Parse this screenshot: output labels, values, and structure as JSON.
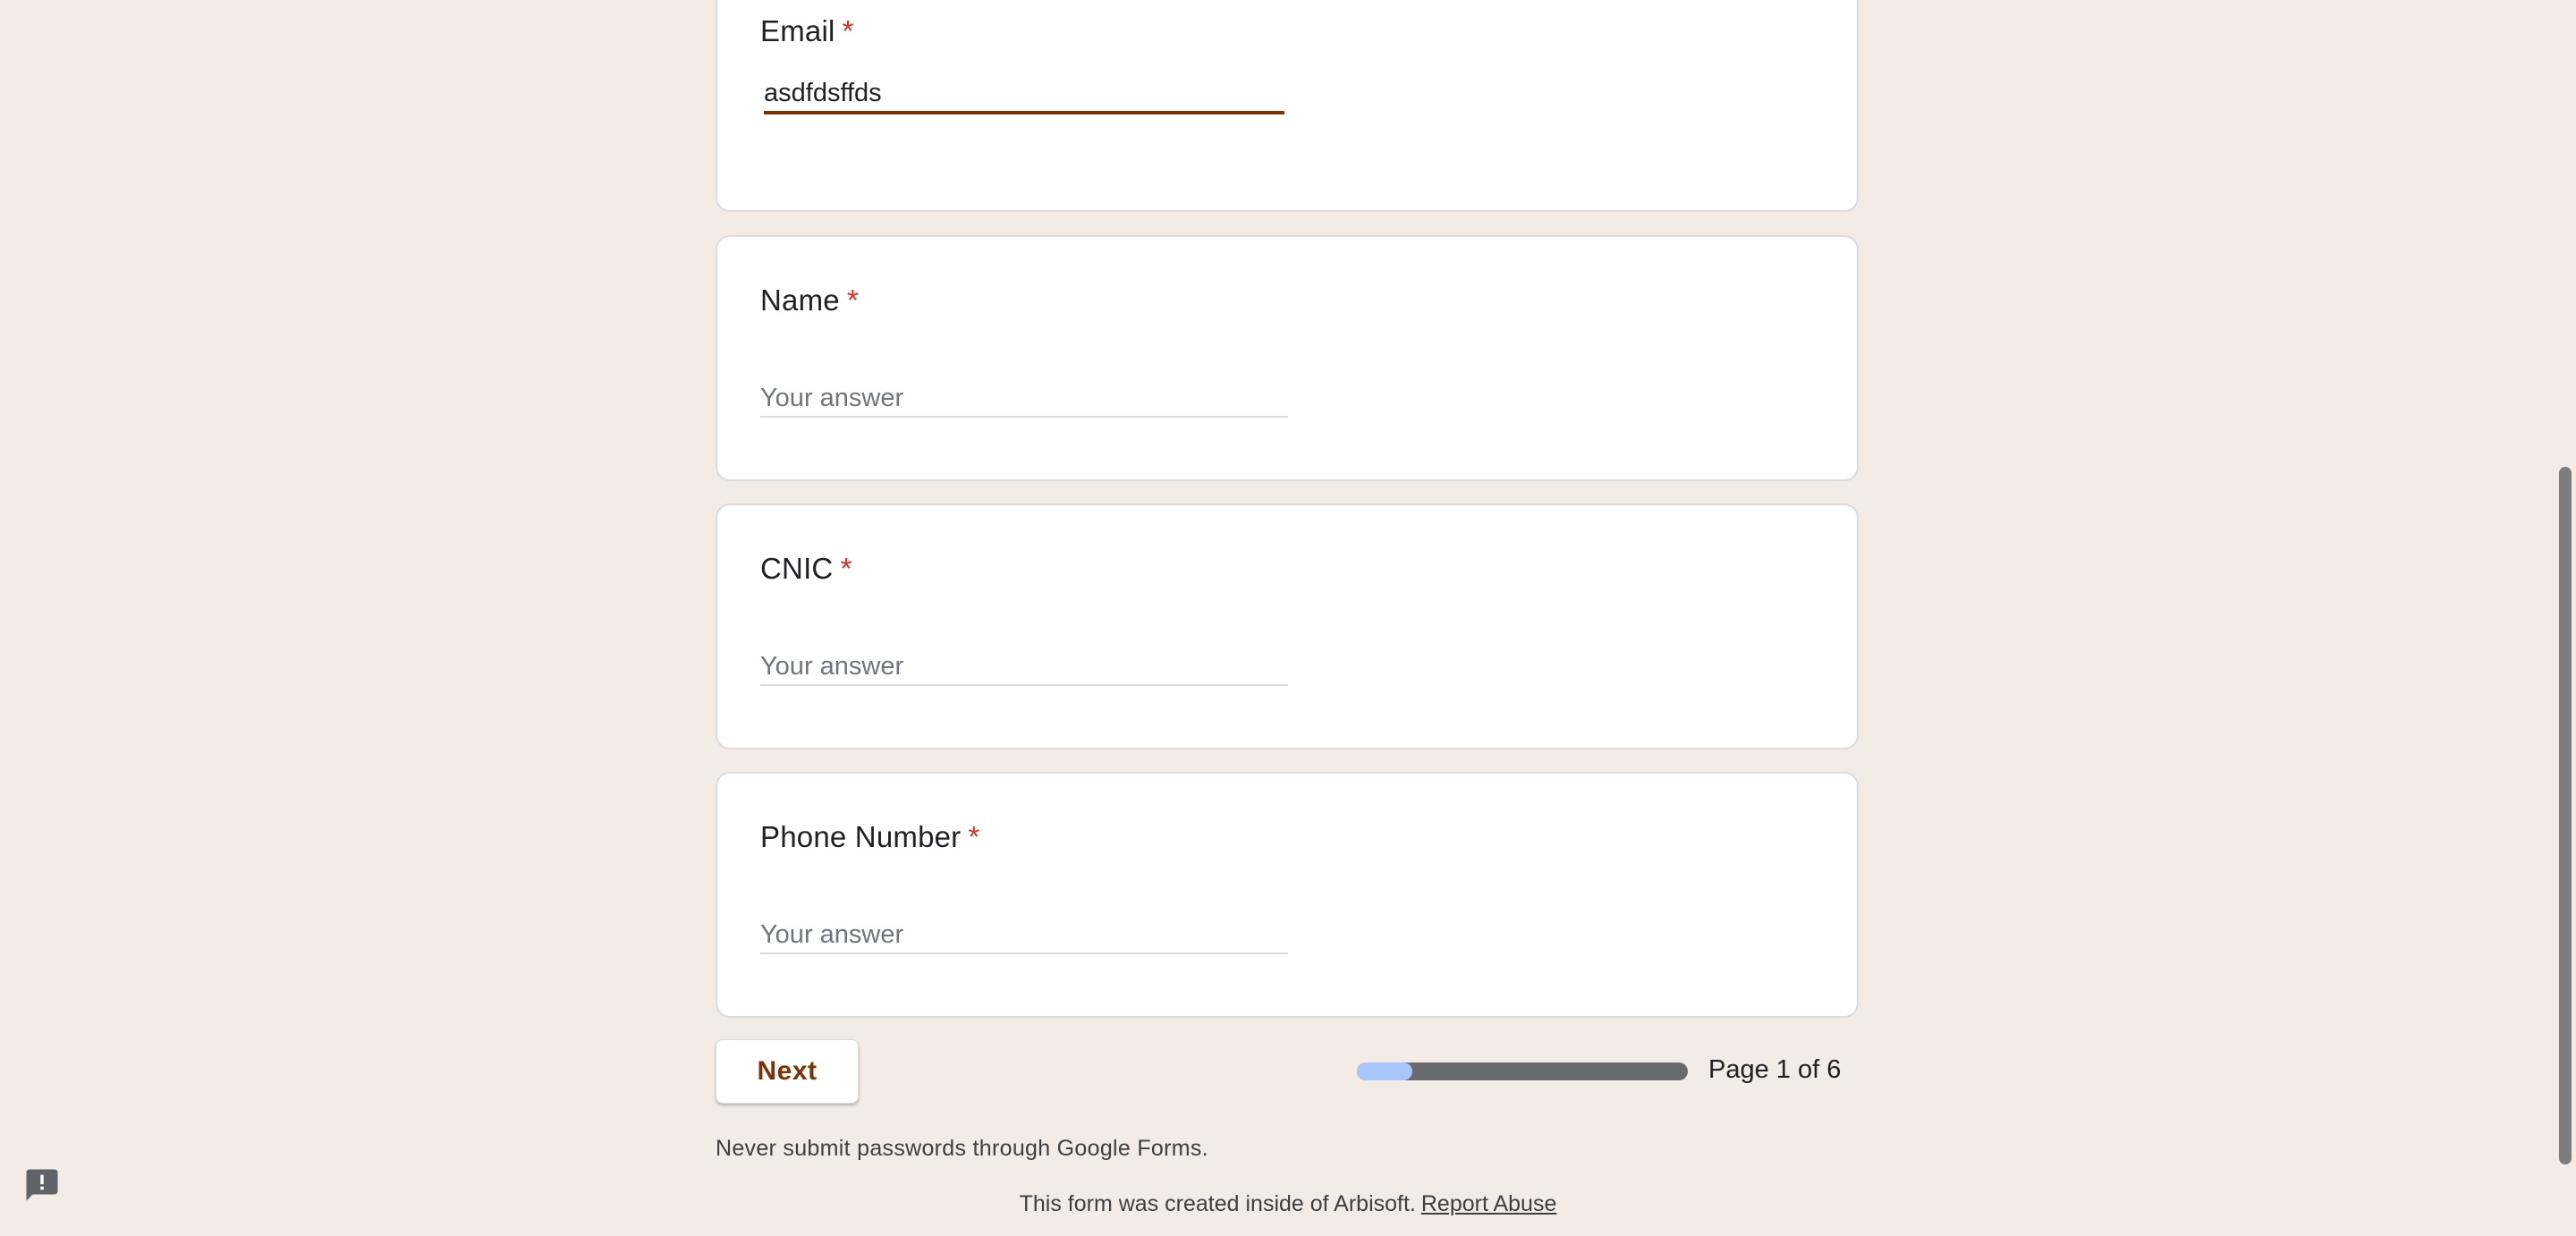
{
  "questions": [
    {
      "title": "Email",
      "required_mark": "*",
      "value": "asdfdsffds",
      "placeholder": "Your answer"
    },
    {
      "title": "Name",
      "required_mark": "*",
      "value": "",
      "placeholder": "Your answer"
    },
    {
      "title": "CNIC",
      "required_mark": "*",
      "value": "",
      "placeholder": "Your answer"
    },
    {
      "title": "Phone Number",
      "required_mark": "*",
      "value": "",
      "placeholder": "Your answer"
    }
  ],
  "navigation": {
    "next_label": "Next",
    "page_label": "Page 1 of 6",
    "progress_fraction": 0.1667
  },
  "notice": "Never submit passwords through Google Forms.",
  "footer": {
    "text": "This form was created inside of Arbisoft.",
    "report_link": "Report Abuse"
  },
  "icons": {
    "feedback": "feedback-icon"
  },
  "colors": {
    "accent": "#7b3306",
    "required": "#d93025",
    "background": "#f3ebe6",
    "progress_fill": "#a7c7fa",
    "progress_track": "#686a6d"
  }
}
